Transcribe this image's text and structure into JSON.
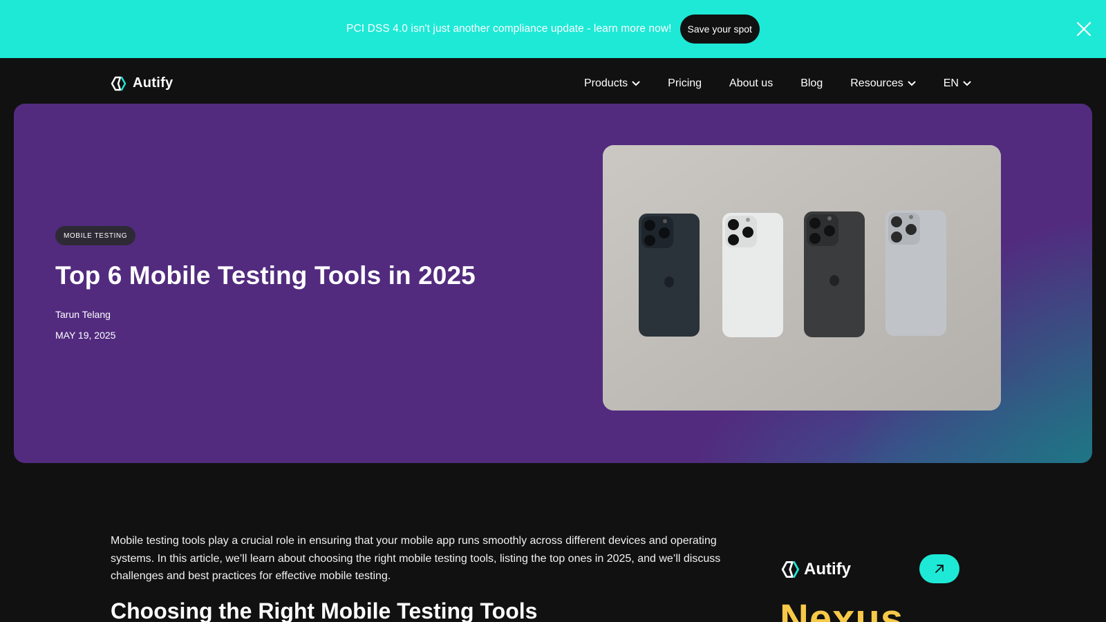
{
  "announcement": {
    "text": "PCI DSS 4.0 isn't just another compliance update - learn more now!",
    "button_label": "Save your spot",
    "close_icon": "close-icon"
  },
  "header": {
    "logo_text": "Autify",
    "nav": [
      {
        "label": "Products",
        "has_dropdown": true
      },
      {
        "label": "Pricing",
        "has_dropdown": false
      },
      {
        "label": "About us",
        "has_dropdown": false
      },
      {
        "label": "Blog",
        "has_dropdown": false
      },
      {
        "label": "Resources",
        "has_dropdown": true
      },
      {
        "label": "EN",
        "has_dropdown": true
      }
    ]
  },
  "hero": {
    "tag": "MOBILE TESTING",
    "title": "Top 6 Mobile Testing Tools in 2025",
    "author": "Tarun Telang",
    "date": "MAY 19, 2025"
  },
  "article": {
    "intro": "Mobile testing tools play a crucial role in ensuring that your mobile app runs smoothly across different devices and operating systems. In this article, we’ll learn about choosing the right mobile testing tools, listing the top ones in 2025, and we’ll discuss challenges and best practices for effective mobile testing.",
    "heading": "Choosing the Right Mobile Testing Tools"
  },
  "sidebar": {
    "logo_text": "Autify",
    "promo_title": "Nexus",
    "arrow_icon": "arrow-up-right-icon"
  },
  "colors": {
    "accent": "#1de9d6",
    "hero_bg": "#522b7f",
    "page_bg": "#111111",
    "promo_yellow": "#f7c948"
  }
}
